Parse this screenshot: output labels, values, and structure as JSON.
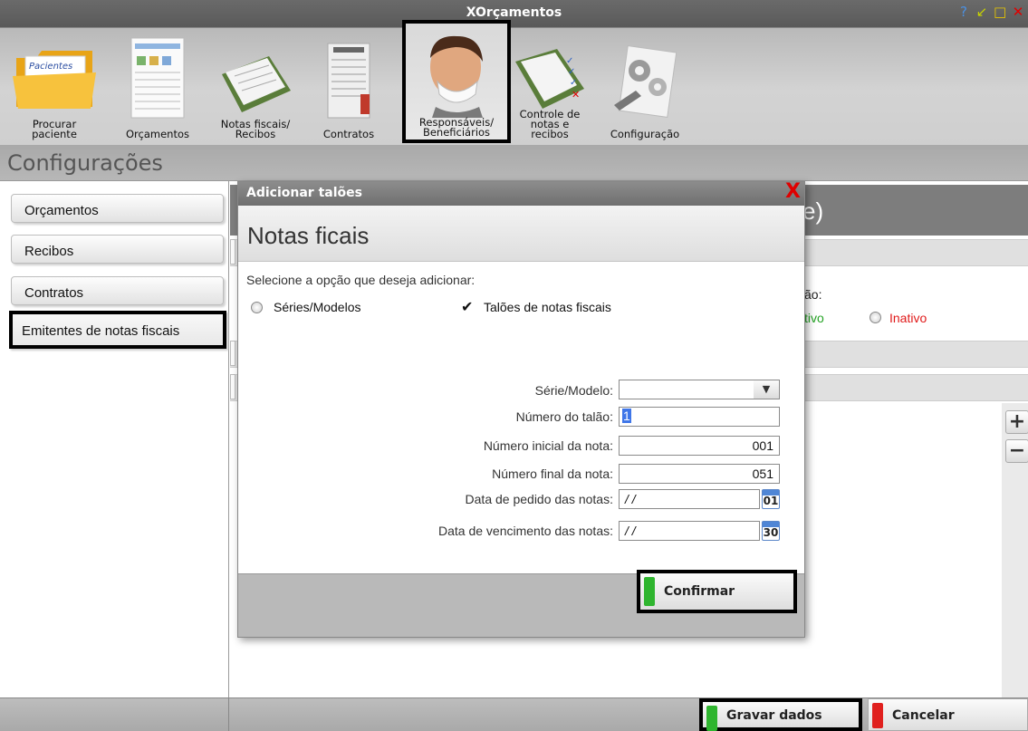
{
  "app": {
    "title": "XOrçamentos"
  },
  "toolbar": {
    "items": [
      {
        "label": "Procurar paciente",
        "folder_text": "Pacientes"
      },
      {
        "label": "Orçamentos"
      },
      {
        "label": "Notas fiscais/ Recibos"
      },
      {
        "label": "Contratos"
      },
      {
        "label": "Responsáveis/ Beneficiários"
      },
      {
        "label": "Controle de notas e recibos"
      },
      {
        "label": "Configuração"
      }
    ]
  },
  "section": {
    "title": "Configurações"
  },
  "sidebar": {
    "items": [
      {
        "label": "Orçamentos"
      },
      {
        "label": "Recibos"
      },
      {
        "label": "Contratos"
      },
      {
        "label": "Emitentes de notas fiscais"
      }
    ]
  },
  "background": {
    "header_fragment": "e)",
    "status_label_fragment": "ão:",
    "active_fragment": "tivo",
    "inactive_label": "Inativo"
  },
  "modal": {
    "title": "Adicionar talões",
    "close_glyph": "X",
    "heading": "Notas ficais",
    "instruction": "Selecione a opção que deseja adicionar:",
    "options": [
      {
        "label": "Séries/Modelos",
        "selected": false
      },
      {
        "label": "Talões de notas fiscais",
        "selected": true
      }
    ],
    "fields": {
      "serie_label": "Série/Modelo:",
      "serie_value": "",
      "talao_label": "Número do talão:",
      "talao_value": "1",
      "inicial_label": "Número inicial da nota:",
      "inicial_value": "001",
      "final_label": "Número final da nota:",
      "final_value": "051",
      "pedido_label": "Data de pedido das notas:",
      "pedido_value": "/ /",
      "pedido_cal_day": "01",
      "venc_label": "Data de vencimento das notas:",
      "venc_value": "/ /",
      "venc_cal_day": "30"
    },
    "confirm_label": "Confirmar"
  },
  "footer": {
    "save_label": "Gravar dados",
    "cancel_label": "Cancelar"
  },
  "side_buttons": {
    "add": "+",
    "remove": "−"
  },
  "colors": {
    "accent_green": "#2fb52f",
    "accent_red": "#e0201e",
    "close_red": "#e00000",
    "active_green": "#24a324",
    "inactive_red": "#e01a1a",
    "selection_blue": "#3f76e8"
  }
}
